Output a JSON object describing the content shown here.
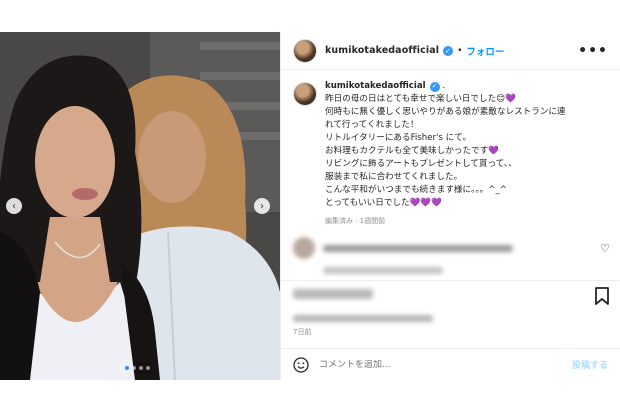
{
  "post": {
    "username": "kumikotakedaofficial",
    "follow_label": "フォロー",
    "separator": "•",
    "more_label": "•••"
  },
  "caption": {
    "username": "kumikotakedaofficial",
    "suffix": ".",
    "lines": [
      "昨日の母の日はとても幸せで楽しい日でした😊💜",
      "何時もに無く優しく思いやりがある娘が素敵なレストランに連",
      "れて行ってくれました！",
      "リトルイタリーにあるFisher's にて。",
      "お料理もカクテルも全て美味しかったです💜",
      "リビングに飾るアートもプレゼントして貰って、、",
      "服装まで私に合わせてくれました。",
      "こんな平和がいつまでも続きます様に。。。^_^",
      "とってもいい日でした💜💜💜"
    ],
    "meta": "編集済み · 1週間前"
  },
  "timestamp": "7日前",
  "comment": {
    "placeholder": "コメントを追加...",
    "post_label": "投稿する"
  },
  "colors": {
    "accent": "#0095f6",
    "verified": "#3897f0"
  },
  "icons": {
    "prev": "chevron-left-icon",
    "next": "chevron-right-icon",
    "heart": "heart-icon",
    "bookmark": "bookmark-icon",
    "emoji": "smiley-icon"
  }
}
